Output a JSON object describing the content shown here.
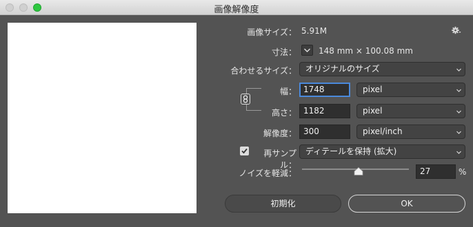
{
  "window": {
    "title": "画像解像度"
  },
  "image_size": {
    "label": "画像サイズ：",
    "value": "5.91M"
  },
  "dimensions": {
    "label": "寸法：",
    "value": "148 mm × 100.08 mm"
  },
  "fit_to": {
    "label": "合わせるサイズ：",
    "value": "オリジナルのサイズ"
  },
  "width": {
    "label": "幅：",
    "value": "1748",
    "unit": "pixel"
  },
  "height": {
    "label": "高さ：",
    "value": "1182",
    "unit": "pixel"
  },
  "resolution": {
    "label": "解像度：",
    "value": "300",
    "unit": "pixel/inch"
  },
  "resample": {
    "label": "再サンプル：",
    "checked": true,
    "value": "ディテールを保持 (拡大)"
  },
  "noise": {
    "label": "ノイズを軽減：",
    "value": "27",
    "unit": "%",
    "fraction": 0.27
  },
  "buttons": {
    "reset": "初期化",
    "ok": "OK"
  },
  "icons": {
    "settings": "gear-icon",
    "dimensions_toggle": "chevron-down-icon",
    "constrain": "chain-link-icon",
    "dropdown": "chevron-down-icon"
  },
  "colors": {
    "accent_focus": "#4a89dc",
    "zoom": "#2ec840"
  }
}
